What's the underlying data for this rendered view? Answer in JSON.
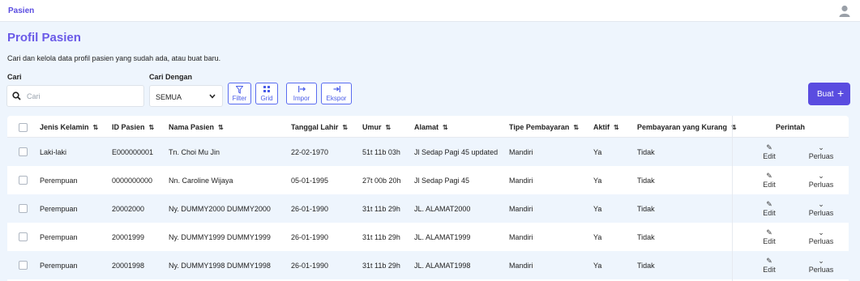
{
  "topbar": {
    "breadcrumb": "Pasien",
    "user_icon": "user-icon"
  },
  "page": {
    "title": "Profil Pasien",
    "subtitle": "Cari dan kelola data profil pasien yang sudah ada, atau buat baru."
  },
  "search": {
    "label": "Cari",
    "placeholder": "Cari",
    "value": ""
  },
  "search_by": {
    "label": "Cari Dengan",
    "value": "SEMUA"
  },
  "toolbar": {
    "filter": "Filter",
    "grid": "Grid",
    "import": "Impor",
    "export": "Ekspor",
    "create": "Buat"
  },
  "table": {
    "headers": {
      "gender": "Jenis Kelamin",
      "id": "ID Pasien",
      "name": "Nama Pasien",
      "dob": "Tanggal Lahir",
      "age": "Umur",
      "address": "Alamat",
      "payment_type": "Tipe Pembayaran",
      "active": "Aktif",
      "missing_payment": "Pembayaran yang Kurang",
      "actions": "Perintah"
    },
    "rows": [
      {
        "gender": "Laki-laki",
        "id": "E000000001",
        "name": "Tn. Choi Mu Jin",
        "dob": "22-02-1970",
        "age": "51t 11b 03h",
        "address": "Jl Sedap Pagi 45 updated",
        "payment_type": "Mandiri",
        "active": "Ya",
        "missing_payment": "Tidak",
        "edit": "Edit",
        "expand": "Perluas"
      },
      {
        "gender": "Perempuan",
        "id": "0000000000",
        "name": "Nn. Caroline Wijaya",
        "dob": "05-01-1995",
        "age": "27t 00b 20h",
        "address": "Jl Sedap Pagi 45",
        "payment_type": "Mandiri",
        "active": "Ya",
        "missing_payment": "Tidak",
        "edit": "Edit",
        "expand": "Perluas"
      },
      {
        "gender": "Perempuan",
        "id": "20002000",
        "name": "Ny. DUMMY2000 DUMMY2000",
        "dob": "26-01-1990",
        "age": "31t 11b 29h",
        "address": "JL. ALAMAT2000",
        "payment_type": "Mandiri",
        "active": "Ya",
        "missing_payment": "Tidak",
        "edit": "Edit",
        "expand": "Perluas"
      },
      {
        "gender": "Perempuan",
        "id": "20001999",
        "name": "Ny. DUMMY1999 DUMMY1999",
        "dob": "26-01-1990",
        "age": "31t 11b 29h",
        "address": "JL. ALAMAT1999",
        "payment_type": "Mandiri",
        "active": "Ya",
        "missing_payment": "Tidak",
        "edit": "Edit",
        "expand": "Perluas"
      },
      {
        "gender": "Perempuan",
        "id": "20001998",
        "name": "Ny. DUMMY1998 DUMMY1998",
        "dob": "26-01-1990",
        "age": "31t 11b 29h",
        "address": "JL. ALAMAT1998",
        "payment_type": "Mandiri",
        "active": "Ya",
        "missing_payment": "Tidak",
        "edit": "Edit",
        "expand": "Perluas"
      }
    ]
  },
  "colors": {
    "accent": "#5a4ce0",
    "title": "#6a5ae8",
    "background": "#eef5fd"
  }
}
